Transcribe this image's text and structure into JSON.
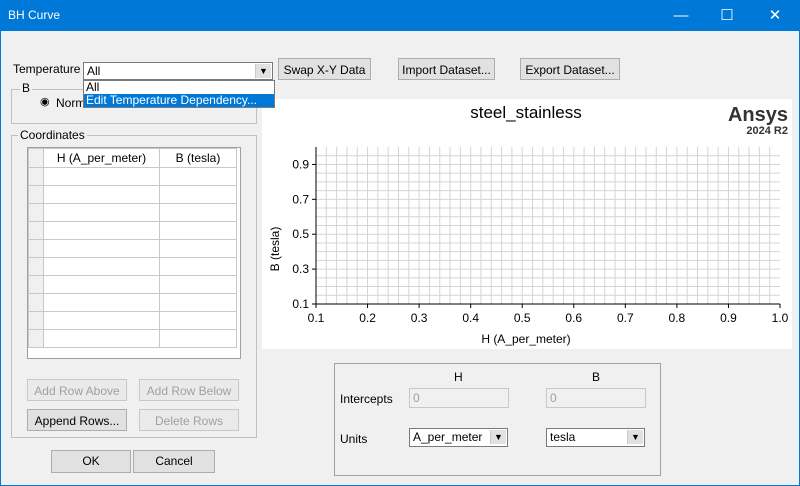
{
  "window": {
    "title": "BH Curve",
    "minimize": "—",
    "maximize": "☐",
    "close": "✕"
  },
  "temperature": {
    "label": "Temperature",
    "value": "All",
    "options": [
      "All",
      "Edit Temperature Dependency..."
    ]
  },
  "toolbar": {
    "swap": "Swap X-Y Data",
    "import": "Import Dataset...",
    "export": "Export Dataset..."
  },
  "b_group": {
    "label": "B",
    "radio_label": "Norm"
  },
  "coordinates": {
    "label": "Coordinates",
    "columns": [
      "H (A_per_meter)",
      "B (tesla)"
    ],
    "row_count": 10
  },
  "row_buttons": {
    "add_above": "Add Row Above",
    "add_below": "Add Row Below",
    "append": "Append Rows...",
    "delete": "Delete Rows"
  },
  "footer": {
    "ok": "OK",
    "cancel": "Cancel"
  },
  "brand": {
    "name": "Ansys",
    "version": "2024 R2"
  },
  "chart_data": {
    "type": "line",
    "title": "steel_stainless",
    "xlabel": "H (A_per_meter)",
    "ylabel": "B (tesla)",
    "xlim": [
      0.1,
      1.0
    ],
    "ylim": [
      0.1,
      1.0
    ],
    "xticks": [
      "0.1",
      "0.2",
      "0.3",
      "0.4",
      "0.5",
      "0.6",
      "0.7",
      "0.8",
      "0.9",
      "1.0"
    ],
    "yticks": [
      "0.1",
      "0.3",
      "0.5",
      "0.7",
      "0.9"
    ],
    "grid": true,
    "series": []
  },
  "params": {
    "col_h": "H",
    "col_b": "B",
    "intercepts_label": "Intercepts",
    "intercept_h": "0",
    "intercept_b": "0",
    "units_label": "Units",
    "unit_h": "A_per_meter",
    "unit_b": "tesla"
  }
}
